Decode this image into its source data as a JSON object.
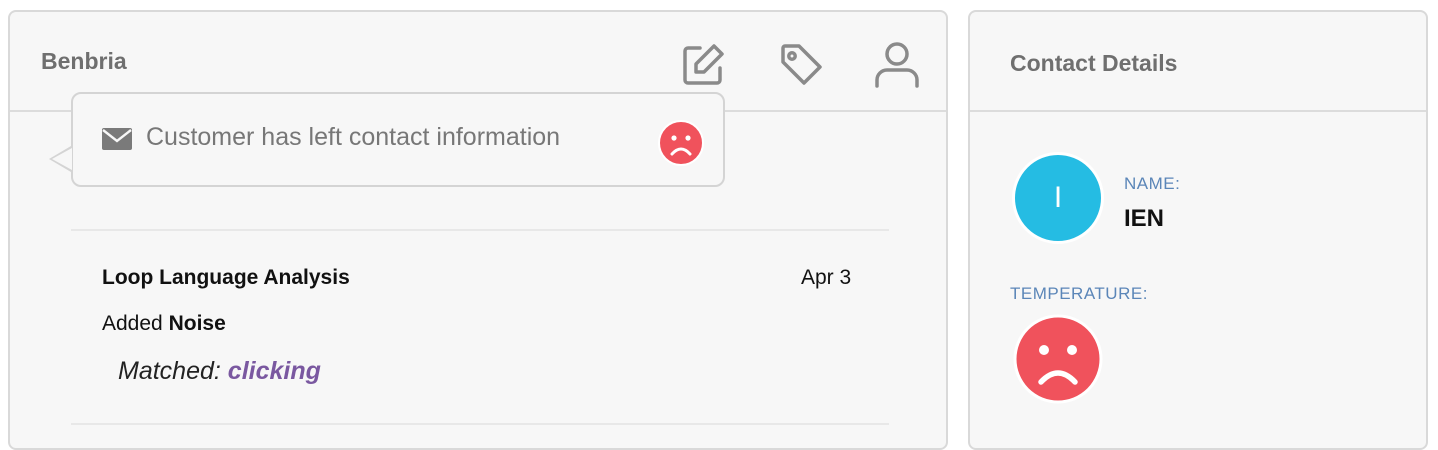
{
  "conversation": {
    "title": "Benbria",
    "icons": [
      "edit-icon",
      "tag-icon",
      "user-icon"
    ],
    "bubble": {
      "icon": "mail-icon",
      "text": "Customer has left contact information",
      "sentiment_icon": "sad-face-icon"
    },
    "entry": {
      "title": "Loop Language Analysis",
      "date": "Apr 3",
      "added_prefix": "Added",
      "added_value": "Noise",
      "matched_label": "Matched:",
      "matched_value": "clicking"
    }
  },
  "contact": {
    "title": "Contact Details",
    "avatar_initial": "I",
    "name_label": "NAME:",
    "name_value": "IEN",
    "temperature_label": "TEMPERATURE:",
    "temperature_icon": "sad-face-icon"
  },
  "colors": {
    "accent_blue": "#25bce3",
    "sad_red": "#f0525c",
    "label_blue": "#5b86b8",
    "keyword_purple": "#7a58a0"
  }
}
